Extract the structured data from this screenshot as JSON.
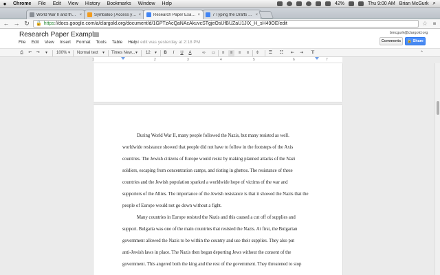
{
  "menubar": {
    "apple": "",
    "items": [
      "Chrome",
      "File",
      "Edit",
      "View",
      "History",
      "Bookmarks",
      "Window",
      "Help"
    ],
    "battery": "42%",
    "clock": "Thu 9:00 AM",
    "user": "Brian McGurk"
  },
  "tabs": [
    {
      "title": "World War II and the Holoc",
      "color": "#8a8f96"
    },
    {
      "title": "Symbaloo | Access your b",
      "color": "#f29c1f"
    },
    {
      "title": "Research Paper Example",
      "color": "#4285f4"
    },
    {
      "title": "7 Typing the Drafts - Goo",
      "color": "#4285f4"
    }
  ],
  "address": {
    "scheme": "https",
    "rest": "://docs.google.com/a/clargold.org/document/d/1GPTzAcQaNAcAkuvcSTgjeOsUfBUZaU1JIX_H_sH49OE/edit"
  },
  "doc": {
    "title": "Research Paper Example",
    "menu": [
      "File",
      "Edit",
      "View",
      "Insert",
      "Format",
      "Tools",
      "Table",
      "Help"
    ],
    "last_edit": "Last edit was yesterday at 2:18 PM",
    "account": "bmcgurk@clargold.org",
    "comments_label": "Comments",
    "share_label": "Share"
  },
  "format_toolbar": {
    "zoom": "100%",
    "style": "Normal text",
    "font": "Times New...",
    "size": "12"
  },
  "ruler": [
    "1",
    "2",
    "3",
    "4",
    "5",
    "6",
    "7"
  ],
  "body_lines": [
    {
      "text": "During World War II, many people followed the Nazis, but many resisted as well.",
      "indent": true
    },
    {
      "text": "worldwide resistance showed that people did not have to follow in the footsteps of the Axis",
      "indent": false
    },
    {
      "text": "countries. The Jewish citizens of Europe would resist by making planned attacks of the Nazi",
      "indent": false
    },
    {
      "text": "soldiers, escaping from concentration camps, and rioting in ghettos. The resistance of these",
      "indent": false
    },
    {
      "text": "countries and the Jewish population sparked a worldwide hope of victims of the war and",
      "indent": false
    },
    {
      "text": "supporters of the Allies. The importance of the Jewish resistance is that it showed the Nazis that the",
      "indent": false
    },
    {
      "text": "people of Europe would not go down without a fight.",
      "indent": false
    },
    {
      "text": "Many countries in Europe resisted the Nazis and this caused a cut off of supplies and",
      "indent": true
    },
    {
      "text": "support. Bulgaria was one of the main countries that resisted the Nazis. At first, the Bulgarian",
      "indent": false
    },
    {
      "text": "government allowed the Nazis to be within the country and use their supplies. They also put",
      "indent": false
    },
    {
      "text": "anti-Jewish laws in place. The Nazis then began deporting Jews without the consent of the",
      "indent": false
    },
    {
      "text": "government. This angered both the king and the rest of the government. They threatened to stop",
      "indent": false
    }
  ]
}
